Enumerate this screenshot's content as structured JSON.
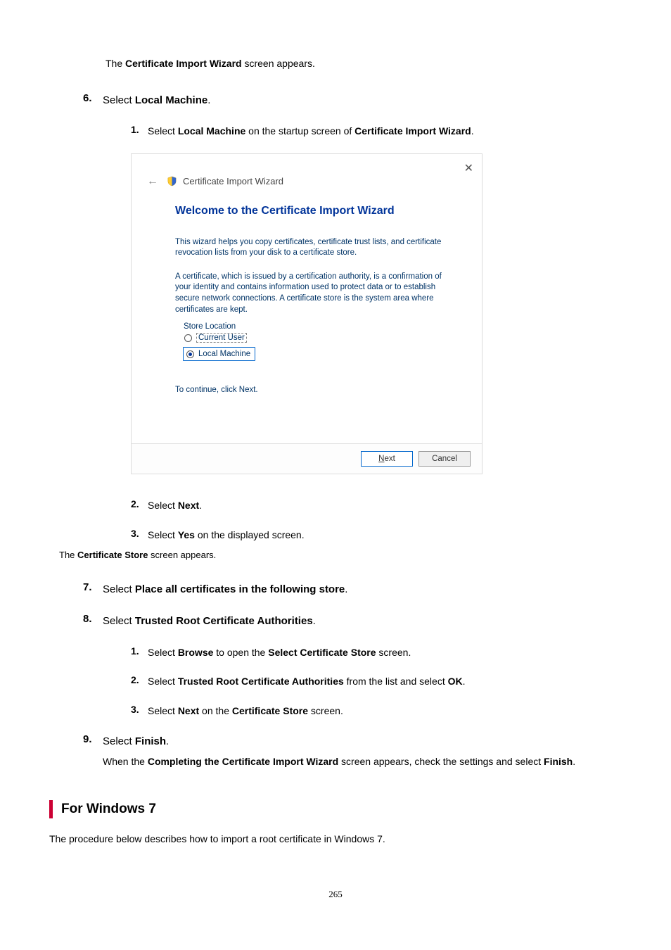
{
  "intro_note": {
    "prefix": "The ",
    "bold": "Certificate Import Wizard",
    "suffix": " screen appears."
  },
  "step6": {
    "num": "6.",
    "prefix": "Select ",
    "bold": "Local Machine",
    "suffix": "."
  },
  "step6_1": {
    "num": "1.",
    "t1": "Select ",
    "b1": "Local Machine",
    "t2": " on the startup screen of ",
    "b2": "Certificate Import Wizard",
    "t3": "."
  },
  "wizard": {
    "header": "Certificate Import Wizard",
    "title": "Welcome to the Certificate Import Wizard",
    "para1": "This wizard helps you copy certificates, certificate trust lists, and certificate revocation lists from your disk to a certificate store.",
    "para2": "A certificate, which is issued by a certification authority, is a confirmation of your identity and contains information used to protect data or to establish secure network connections. A certificate store is the system area where certificates are kept.",
    "legend": "Store Location",
    "opt_current_user": "Current User",
    "opt_local_machine": "Local Machine",
    "continue": "To continue, click Next.",
    "next_u": "N",
    "next_rest": "ext",
    "cancel": "Cancel"
  },
  "step6_2": {
    "num": "2.",
    "t1": "Select ",
    "b1": "Next",
    "t2": "."
  },
  "step6_3": {
    "num": "3.",
    "t1": "Select ",
    "b1": "Yes",
    "t2": " on the displayed screen.",
    "note_prefix": "The ",
    "note_bold": "Certificate Store",
    "note_suffix": " screen appears."
  },
  "step7": {
    "num": "7.",
    "t1": "Select ",
    "b1": "Place all certificates in the following store",
    "t2": "."
  },
  "step8": {
    "num": "8.",
    "t1": "Select ",
    "b1": "Trusted Root Certificate Authorities",
    "t2": "."
  },
  "step8_1": {
    "num": "1.",
    "t1": "Select ",
    "b1": "Browse",
    "t2": " to open the ",
    "b2": "Select Certificate Store",
    "t3": " screen."
  },
  "step8_2": {
    "num": "2.",
    "t1": "Select ",
    "b1": "Trusted Root Certificate Authorities",
    "t2": " from the list and select ",
    "b2": "OK",
    "t3": "."
  },
  "step8_3": {
    "num": "3.",
    "t1": "Select ",
    "b1": "Next",
    "t2": " on the ",
    "b2": "Certificate Store",
    "t3": " screen."
  },
  "step9": {
    "num": "9.",
    "t1": "Select ",
    "b1": "Finish",
    "t2": ".",
    "n_t1": "When the ",
    "n_b1": "Completing the Certificate Import Wizard",
    "n_t2": " screen appears, check the settings and select ",
    "n_b2": "Finish",
    "n_t3": "."
  },
  "section": {
    "title": "For Windows 7"
  },
  "closing": "The procedure below describes how to import a root certificate in Windows 7.",
  "page_number": "265"
}
